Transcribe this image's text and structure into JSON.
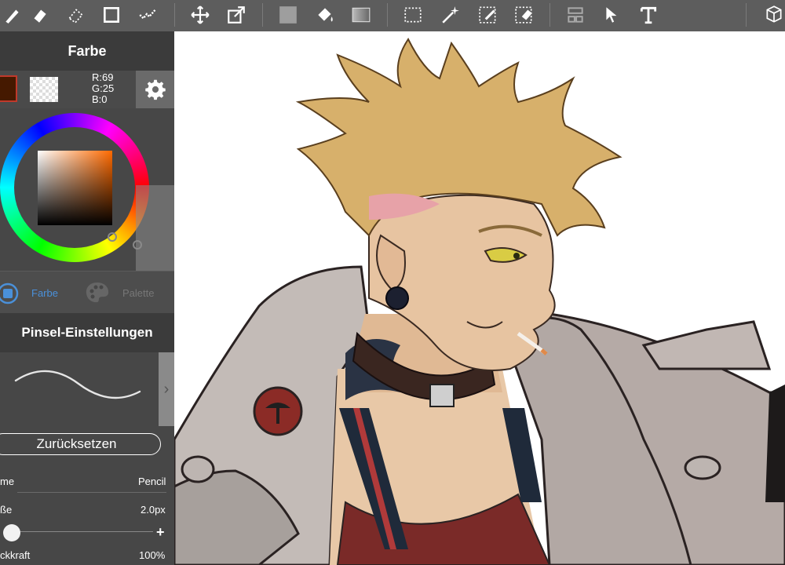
{
  "panel": {
    "color_title": "Farbe",
    "rgb": {
      "r": "R:69",
      "g": "G:25",
      "b": "B:0"
    },
    "modes": {
      "farbe": "Farbe",
      "palette": "Palette"
    },
    "brush_title": "Pinsel-Einstellungen",
    "reset_label": "Zurücksetzen",
    "name_label": "me",
    "name_value": "Pencil",
    "size_label": "ße",
    "size_value": "2.0px",
    "opacity_label": "ckkraft",
    "opacity_value": "100%",
    "plus": "+"
  },
  "toolbar": {
    "icons": [
      "brush-icon",
      "eraser-icon",
      "blur-icon",
      "rectangle-icon",
      "smudge-icon",
      "move-icon",
      "transform-icon",
      "fill-square-icon",
      "bucket-icon",
      "gradient-icon",
      "select-rect-icon",
      "magic-wand-icon",
      "select-pen-icon",
      "select-eraser-icon",
      "layer-arrange-icon",
      "select-arrow-icon",
      "text-icon",
      "materials-icon"
    ]
  },
  "colors": {
    "foreground": "#451900",
    "accent": "#4a90d9"
  }
}
